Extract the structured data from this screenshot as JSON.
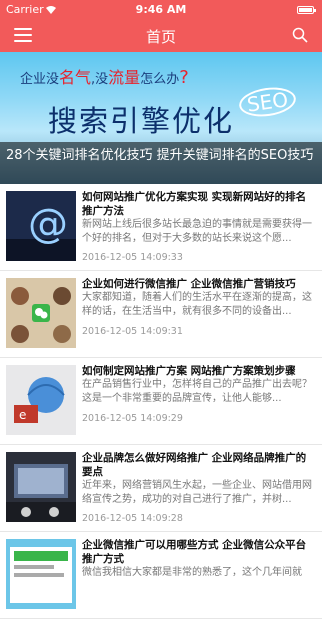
{
  "status": {
    "carrier": "Carrier",
    "time": "9:46 AM"
  },
  "navbar": {
    "title": "首页"
  },
  "banner": {
    "tagline_1": "企业没",
    "tagline_2": "名气",
    "tagline_3": ",没",
    "tagline_4": "流量",
    "tagline_5": "怎么办",
    "tagline_q": "?",
    "headline": "搜索引擎优化",
    "seo": "SEO",
    "caption": "28个关键词排名优化技巧 提升关键词排名的SEO技巧"
  },
  "articles": [
    {
      "title": "如何网站推广优化方案实现 实现新网站好的排名推广方法",
      "summary": "新网站上线后很多站长最急迫的事情就是需要获得一个好的排名，但对于大多数的站长来说这个愿...",
      "date": "2016-12-05 14:09:33"
    },
    {
      "title": "企业如何进行微信推广 企业微信推广营销技巧",
      "summary": "大家都知道，随着人们的生活水平在逐渐的提高，这样的话，在生活当中，就有很多不同的设备出...",
      "date": "2016-12-05 14:09:31"
    },
    {
      "title": "如何制定网站推广方案 网站推广方案策划步骤",
      "summary": "在产品销售行业中，怎样将自己的产品推广出去呢？这是一个非常重要的品牌宣传，让他人能够...",
      "date": "2016-12-05 14:09:29"
    },
    {
      "title": "企业品牌怎么做好网络推广 企业网络品牌推广的要点",
      "summary": "近年来，网络营销风生水起，一些企业、网站借用网络宣传之势，成功的对自己进行了推广，并树...",
      "date": "2016-12-05 14:09:28"
    },
    {
      "title": "企业微信推广可以用哪些方式 企业微信公众平台推广方式",
      "summary": "微信我相信大家都是非常的熟悉了，这个几年间就",
      "date": ""
    }
  ]
}
